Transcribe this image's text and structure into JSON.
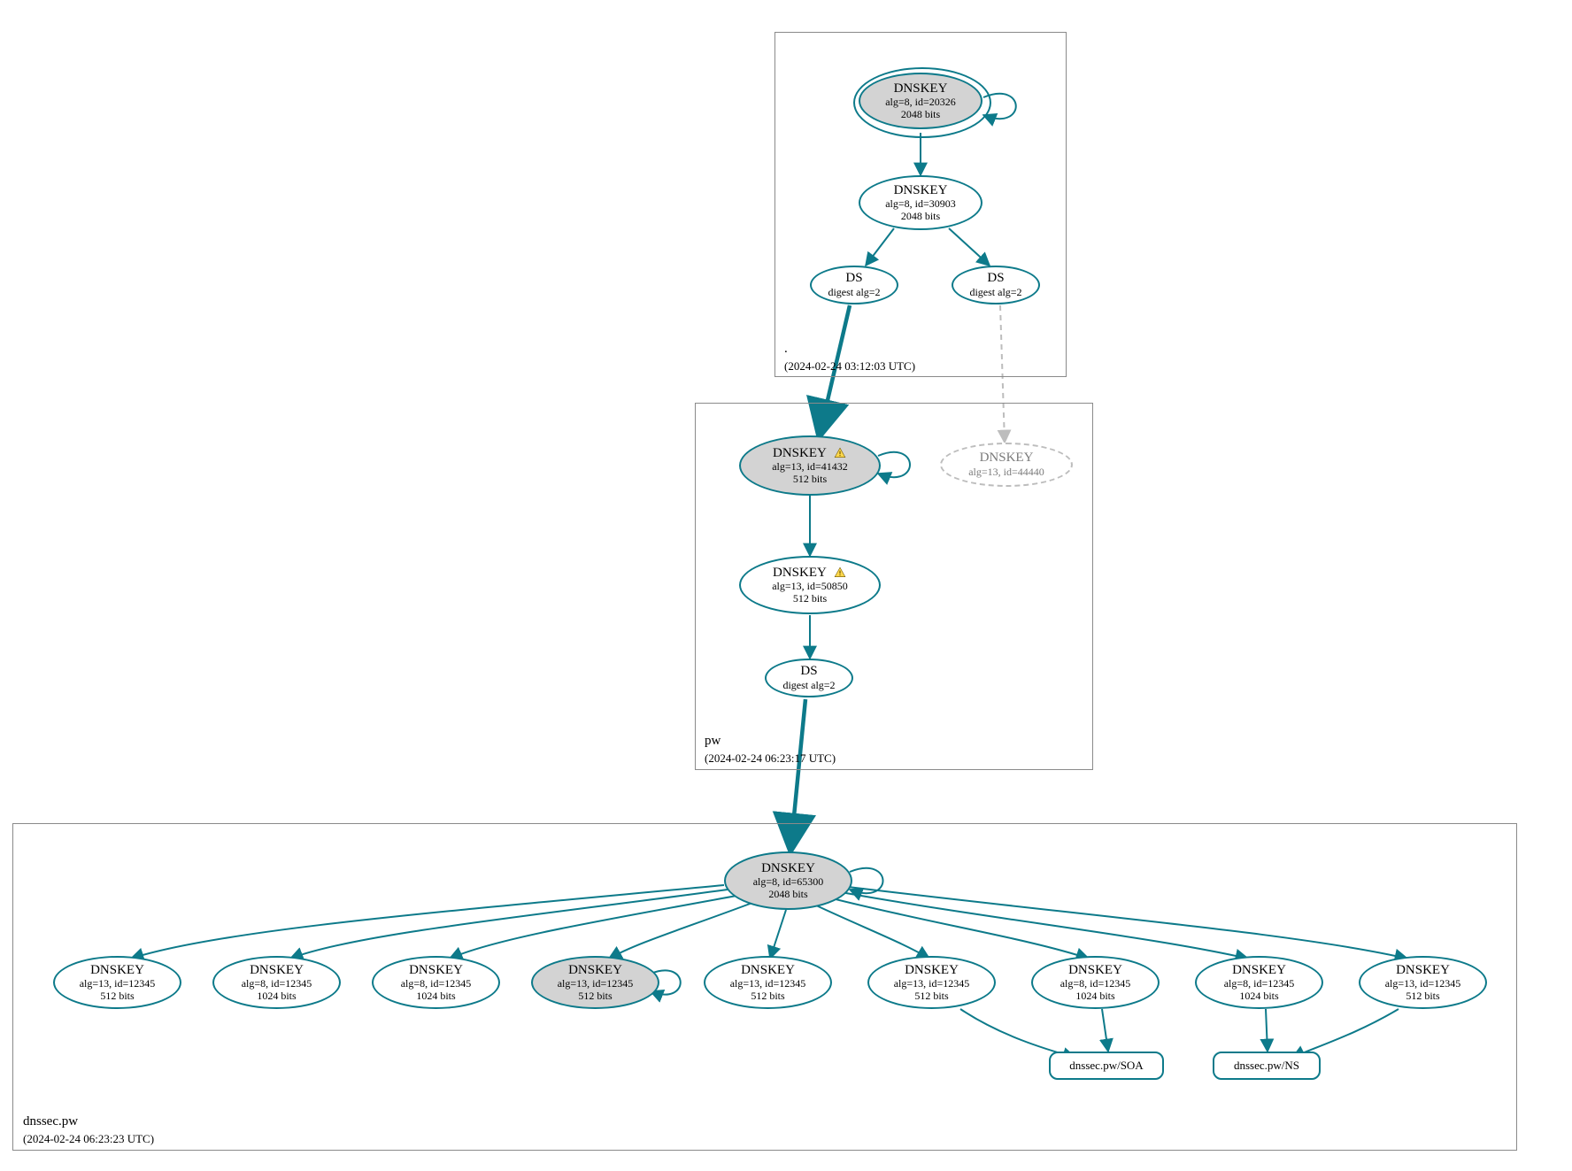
{
  "colors": {
    "stroke": "#0d7a8a",
    "gray": "#bdbdbd",
    "fill_gray": "#d3d3d3"
  },
  "zones": {
    "root": {
      "name": ".",
      "timestamp": "(2024-02-24 03:12:03 UTC)"
    },
    "pw": {
      "name": "pw",
      "timestamp": "(2024-02-24 06:23:17 UTC)"
    },
    "leaf": {
      "name": "dnssec.pw",
      "timestamp": "(2024-02-24 06:23:23 UTC)"
    }
  },
  "nodes": {
    "root_ksk": {
      "title": "DNSKEY",
      "line2": "alg=8, id=20326",
      "line3": "2048 bits"
    },
    "root_zsk": {
      "title": "DNSKEY",
      "line2": "alg=8, id=30903",
      "line3": "2048 bits"
    },
    "root_ds_left": {
      "title": "DS",
      "line2": "digest alg=2"
    },
    "root_ds_right": {
      "title": "DS",
      "line2": "digest alg=2"
    },
    "pw_ksk": {
      "title": "DNSKEY",
      "line2": "alg=13, id=41432",
      "line3": "512 bits",
      "warn": true
    },
    "pw_ghost": {
      "title": "DNSKEY",
      "line2": "alg=13, id=44440"
    },
    "pw_zsk": {
      "title": "DNSKEY",
      "line2": "alg=13, id=50850",
      "line3": "512 bits",
      "warn": true
    },
    "pw_ds": {
      "title": "DS",
      "line2": "digest alg=2"
    },
    "leaf_ksk": {
      "title": "DNSKEY",
      "line2": "alg=8, id=65300",
      "line3": "2048 bits"
    },
    "leaf_k1": {
      "title": "DNSKEY",
      "line2": "alg=13, id=12345",
      "line3": "512 bits"
    },
    "leaf_k2": {
      "title": "DNSKEY",
      "line2": "alg=8, id=12345",
      "line3": "1024 bits"
    },
    "leaf_k3": {
      "title": "DNSKEY",
      "line2": "alg=8, id=12345",
      "line3": "1024 bits"
    },
    "leaf_k4": {
      "title": "DNSKEY",
      "line2": "alg=13, id=12345",
      "line3": "512 bits"
    },
    "leaf_k5": {
      "title": "DNSKEY",
      "line2": "alg=13, id=12345",
      "line3": "512 bits"
    },
    "leaf_k6": {
      "title": "DNSKEY",
      "line2": "alg=13, id=12345",
      "line3": "512 bits"
    },
    "leaf_k7": {
      "title": "DNSKEY",
      "line2": "alg=8, id=12345",
      "line3": "1024 bits"
    },
    "leaf_k8": {
      "title": "DNSKEY",
      "line2": "alg=8, id=12345",
      "line3": "1024 bits"
    },
    "leaf_k9": {
      "title": "DNSKEY",
      "line2": "alg=13, id=12345",
      "line3": "512 bits"
    },
    "rr_soa": {
      "label": "dnssec.pw/SOA"
    },
    "rr_ns": {
      "label": "dnssec.pw/NS"
    }
  }
}
